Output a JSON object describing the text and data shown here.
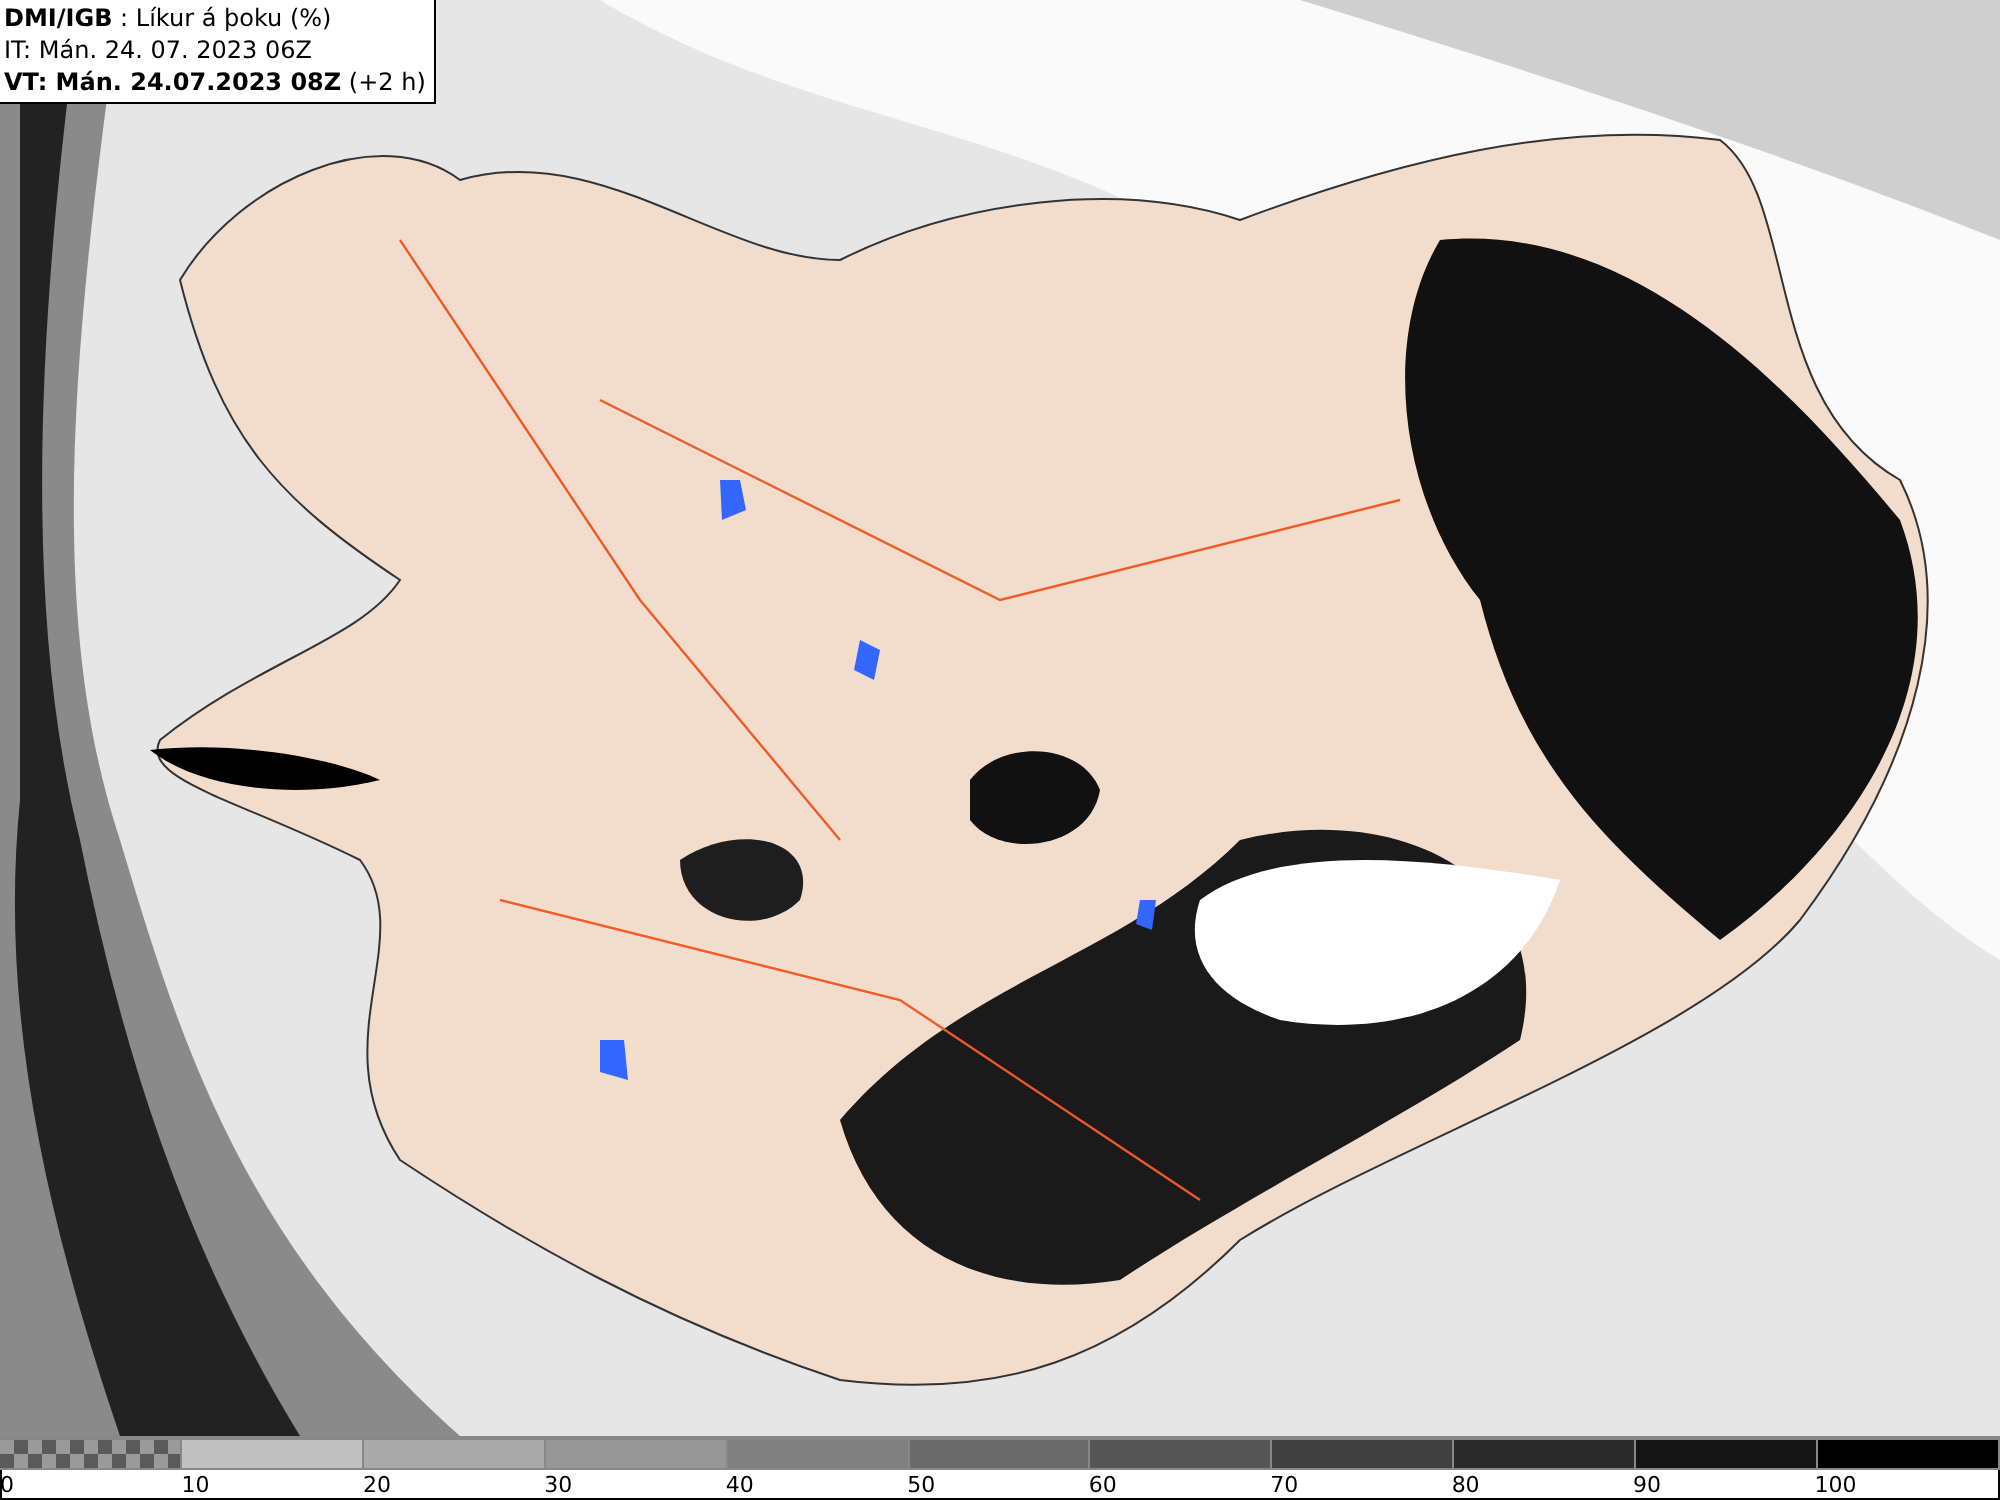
{
  "header": {
    "title": "**DMI/IGB** : Líkur á þoku (%)",
    "issue_time": "IT: Mán. 24. 07. 2023 06Z",
    "valid_time": "**VT: Mán. 24.07.2023 08Z** (+2 h)"
  },
  "legend": [
    {
      "label": "0",
      "kind": "pattern",
      "color": "#5a5a5a"
    },
    {
      "label": "10",
      "kind": "solid",
      "color": "#c0c0c0"
    },
    {
      "label": "20",
      "kind": "solid",
      "color": "#aaaaaa"
    },
    {
      "label": "30",
      "kind": "solid",
      "color": "#969696"
    },
    {
      "label": "40",
      "kind": "solid",
      "color": "#808080"
    },
    {
      "label": "50",
      "kind": "solid",
      "color": "#6a6a6a"
    },
    {
      "label": "60",
      "kind": "solid",
      "color": "#555555"
    },
    {
      "label": "70",
      "kind": "solid",
      "color": "#404040"
    },
    {
      "label": "80",
      "kind": "solid",
      "color": "#2a2a2a"
    },
    {
      "label": "90",
      "kind": "solid",
      "color": "#151515"
    },
    {
      "label": "100",
      "kind": "solid",
      "color": "#000000"
    }
  ]
}
